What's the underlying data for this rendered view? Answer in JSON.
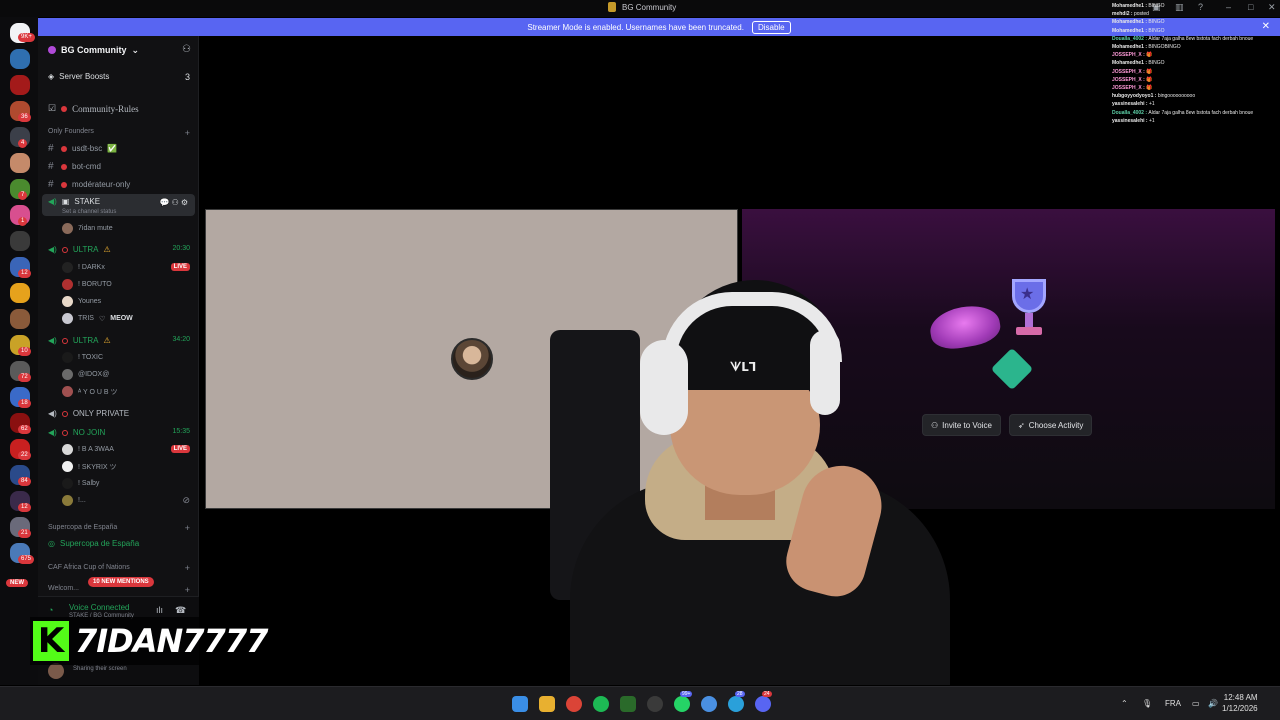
{
  "window": {
    "title": "BG Community"
  },
  "banner": {
    "text": "Streamer Mode is enabled. Usernames have been truncated.",
    "action": "Disable"
  },
  "rail": {
    "top_badge": "9K+",
    "badges": [
      "36",
      "4",
      "7",
      "1",
      "12",
      "10",
      "72",
      "18",
      "62",
      "22",
      "84",
      "12",
      "21",
      "675"
    ],
    "new_label": "NEW"
  },
  "server": {
    "name": "BG Community"
  },
  "sidebar": {
    "boosts_label": "Server Boosts",
    "boosts_count": "3",
    "rules": "Community-Rules",
    "cat_founders": "Only Founders",
    "ch_usdt": "usdt-bsc",
    "ch_bot": "bot-cmd",
    "ch_mod": "modérateur-only",
    "ch_stake": "STAKE",
    "stake_status": "Set a channel status",
    "stake_user": "7idan mute",
    "ch_ultra1": "ULTRA",
    "ultra1_time": "20:30",
    "ultra1_users": [
      "! DARKx",
      "! BORUTO",
      "Younes",
      "TRIS",
      "MEOW"
    ],
    "live": "LIVE",
    "ch_ultra2": "ULTRA",
    "ultra2_time": "34:20",
    "ultra2_users": [
      "! TOXIC",
      "@IDOX@",
      "ᴬ Y O U B ツ"
    ],
    "ch_private": "ONLY PRIVATE",
    "ch_nojoin": "NO JOIN",
    "nojoin_time": "15:35",
    "nojoin_users": [
      "! B A 3WAA",
      "! SKYRIX ツ",
      "! Salby",
      "!..."
    ],
    "cat_supercopa": "Supercopa de España",
    "ch_supercopa": "Supercopa de España",
    "cat_caf": "CAF Africa Cup of Nations",
    "ch_welcome": "Welcom...",
    "mentions": "10 NEW MENTIONS",
    "voice_connected": "Voice Connected",
    "voice_sub": "STAKE / BG Community",
    "sharing": "Sharing their screen"
  },
  "stage": {
    "invite": "Invite to Voice",
    "activity": "Choose Activity"
  },
  "chat": [
    {
      "n": "Mohamedhe1",
      "m": "BINGO"
    },
    {
      "n": "mehdi2",
      "m": "posted"
    },
    {
      "n": "Mohamedhe1",
      "m": "BINGO"
    },
    {
      "n": "Mohamedhe1",
      "m": "BINGO"
    },
    {
      "n": "Doualla_4002",
      "m": "Aldar 7aja galha 8ew bstota fach derbah bnoue"
    },
    {
      "n": "Mohamedhe1",
      "m": "BINGOBINGO"
    },
    {
      "n": "JOSSEPH_X",
      "m": "🎁"
    },
    {
      "n": "Mohamedhe1",
      "m": "BINGO"
    },
    {
      "n": "JOSSEPH_X",
      "m": "🎁"
    },
    {
      "n": "JOSSEPH_X",
      "m": "🎁"
    },
    {
      "n": "JOSSEPH_X",
      "m": "🎁"
    },
    {
      "n": "hubgoyyodyoyo1",
      "m": "bingoooooooooo"
    },
    {
      "n": "yassinesalehi",
      "m": "+1"
    },
    {
      "n": "Doualla_4002",
      "m": "Aldar 7aja galha 8ew bstota fach derbah bnoue"
    },
    {
      "n": "yassinesalehi",
      "m": "+1"
    }
  ],
  "streamer": {
    "name": "7IDAN7777",
    "k": "K"
  },
  "taskbar": {
    "lang": "FRA",
    "time": "12:48 AM",
    "date": "1/12/2026",
    "badge_whatsapp": "99+",
    "badge_opera": "28",
    "badge_discord": "24"
  },
  "colors": {
    "accent": "#5865f2",
    "live": "#da373c",
    "voice_green": "#23a55a",
    "kick_green": "#53fc18"
  }
}
